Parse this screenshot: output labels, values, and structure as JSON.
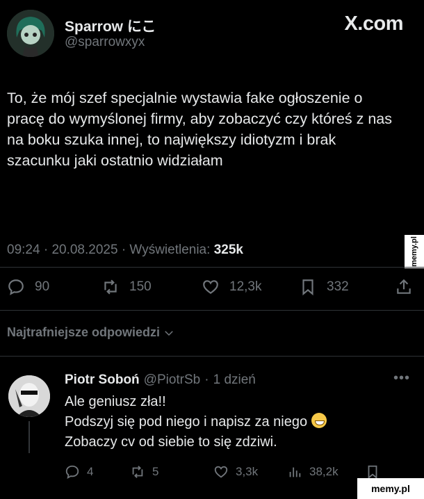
{
  "tweet": {
    "display_name": "Sparrow にこ",
    "handle": "@sparrowxyx",
    "source_label": "X.com",
    "text": "To, że mój szef specjalnie wystawia fake ogłoszenie o pracę do wymyślonej firmy, aby zobaczyć czy któreś z nas na boku szuka innej, to największy idiotyzm i brak szacunku jaki ostatnio widziałam",
    "time": "09:24",
    "date": "20.08.2025",
    "views_label": "Wyświetlenia:",
    "views_count": "325k",
    "replies": "90",
    "retweets": "150",
    "likes": "12,3k",
    "bookmarks": "332"
  },
  "section": {
    "best_replies_label": "Najtrafniejsze odpowiedzi"
  },
  "reply": {
    "display_name": "Piotr Soboń",
    "handle": "@PiotrSb",
    "age": "1 dzień",
    "line1": "Ale geniusz zła!!",
    "line2": "Podszyj się pod niego i napisz za niego",
    "line3": "Zobaczy cv od siebie to się zdziwi.",
    "replies": "4",
    "retweets": "5",
    "likes": "3,3k",
    "views": "38,2k"
  },
  "watermarks": {
    "side": "memy.pl",
    "bottom": "memy.pl"
  },
  "icons": {
    "reply": "speech-bubble-icon",
    "retweet": "retweet-icon",
    "like": "heart-icon",
    "bookmark": "bookmark-icon",
    "share": "share-icon",
    "views": "bar-chart-icon",
    "more": "more-dots-icon"
  },
  "colors": {
    "background": "#000000",
    "text": "#e7e9ea",
    "muted": "#71767b",
    "divider": "#2f3336"
  }
}
